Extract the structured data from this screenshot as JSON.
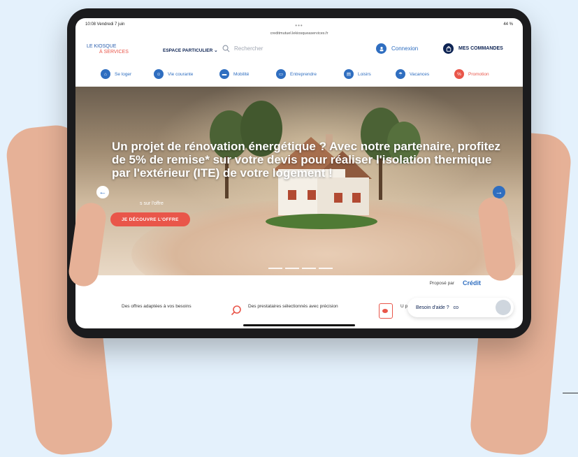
{
  "status": {
    "time": "10:08  Vendredi 7 juin",
    "url": "creditmutuel.lekiosqueaservices.fr",
    "battery": "44 %"
  },
  "header": {
    "logo_line1": "LE KIOSQUE",
    "logo_line2": "À SERVICES",
    "espace": "ESPACE PARTICULIER",
    "search_placeholder": "Rechercher",
    "connexion": "Connexion",
    "commandes": "MES COMMANDES"
  },
  "nav": [
    {
      "label": "Se loger",
      "icon": "home-icon"
    },
    {
      "label": "Vie courante",
      "icon": "user-gear-icon"
    },
    {
      "label": "Mobilité",
      "icon": "car-icon"
    },
    {
      "label": "Entreprendre",
      "icon": "briefcase-icon"
    },
    {
      "label": "Loisirs",
      "icon": "ticket-icon"
    },
    {
      "label": "Vacances",
      "icon": "umbrella-icon"
    },
    {
      "label": "Promotion",
      "icon": "percent-icon"
    }
  ],
  "hero": {
    "headline": "Un projet de rénovation énergétique ? Avec notre partenaire, profitez de 5% de remise* sur votre devis pour réaliser l'isolation thermique par l'extérieur (ITE) de votre logement !",
    "subtext": "s sur l'offre",
    "cta": "JE DÉCOUVRE L'OFFRE"
  },
  "propose": {
    "label": "Proposé par",
    "brand": "Crédit"
  },
  "features": {
    "f1": "Des offres adaptées à vos besoins",
    "f2": "Des prestataires sélectionnés avec précision",
    "f3": "U p",
    "help": "Besoin d'aide ?",
    "help_tail": "co"
  },
  "colors": {
    "accent_blue": "#2f6ec0",
    "accent_red": "#e9564a",
    "navy": "#0e2454",
    "background": "#e4f1fc"
  }
}
